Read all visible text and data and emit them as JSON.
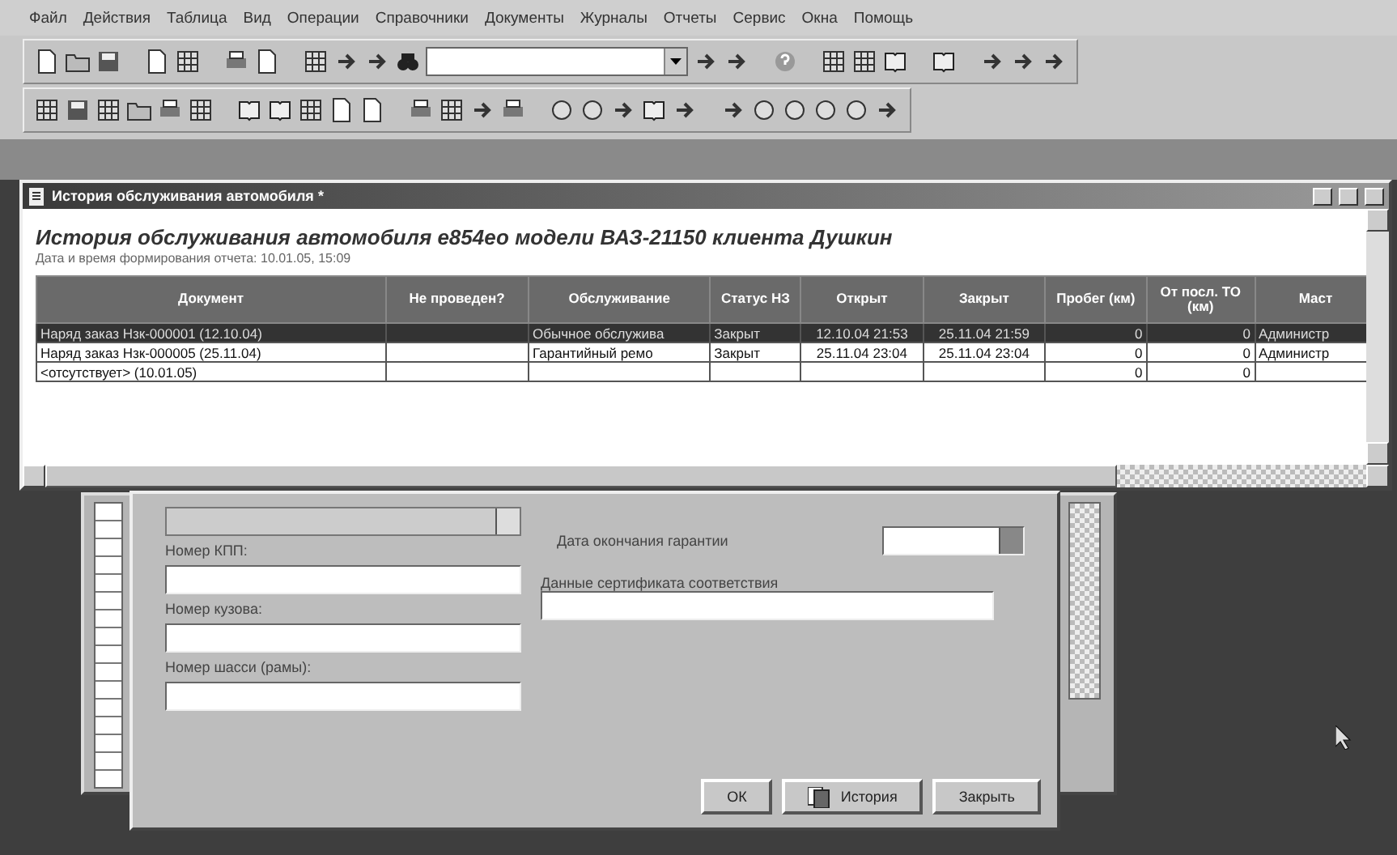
{
  "menu": [
    "Файл",
    "Действия",
    "Таблица",
    "Вид",
    "Операции",
    "Справочники",
    "Документы",
    "Журналы",
    "Отчеты",
    "Сервис",
    "Окна",
    "Помощь"
  ],
  "report_window": {
    "title": "История обслуживания автомобиля *",
    "heading": "История обслуживания автомобиля е854ео модели ВАЗ-21150 клиента Душкин",
    "subtitle": "Дата и время формирования отчета: 10.01.05, 15:09",
    "columns": [
      {
        "label": "Документ"
      },
      {
        "label": "Не проведен?"
      },
      {
        "label": "Обслуживание"
      },
      {
        "label": "Статус НЗ"
      },
      {
        "label": "Открыт"
      },
      {
        "label": "Закрыт"
      },
      {
        "label": "Пробег (км)"
      },
      {
        "label": "От посл. ТО (км)"
      },
      {
        "label": "Маст"
      }
    ],
    "rows": [
      {
        "selected": true,
        "cells": [
          "Наряд заказ Нзк-000001 (12.10.04)",
          null,
          "Обычное обслужива",
          "Закрыт",
          "12.10.04 21:53",
          "25.11.04 21:59",
          "0",
          "0",
          "Администр"
        ]
      },
      {
        "selected": false,
        "cells": [
          "Наряд заказ Нзк-000005 (25.11.04)",
          null,
          "Гарантийный ремо",
          "Закрыт",
          "25.11.04 23:04",
          "25.11.04 23:04",
          "0",
          "0",
          "Администр"
        ]
      },
      {
        "selected": false,
        "cells": [
          "<отсутствует> (10.01.05)",
          null,
          null,
          null,
          null,
          null,
          "0",
          "0",
          null
        ]
      }
    ]
  },
  "dialog": {
    "left_fields": [
      {
        "kind": "combo"
      },
      {
        "kind": "text",
        "label": "Номер КПП:"
      },
      {
        "kind": "text",
        "label": "Номер кузова:"
      },
      {
        "kind": "text",
        "label": "Номер шасси (рамы):"
      }
    ],
    "right_fields": [
      {
        "kind": "date",
        "label": "Дата окончания гарантии"
      },
      {
        "kind": "text",
        "label": "Данные сертификата соответствия"
      }
    ],
    "buttons": [
      {
        "kind": "plain",
        "label": "ОК"
      },
      {
        "kind": "icon",
        "label": "История"
      },
      {
        "kind": "plain",
        "label": "Закрыть"
      }
    ]
  }
}
